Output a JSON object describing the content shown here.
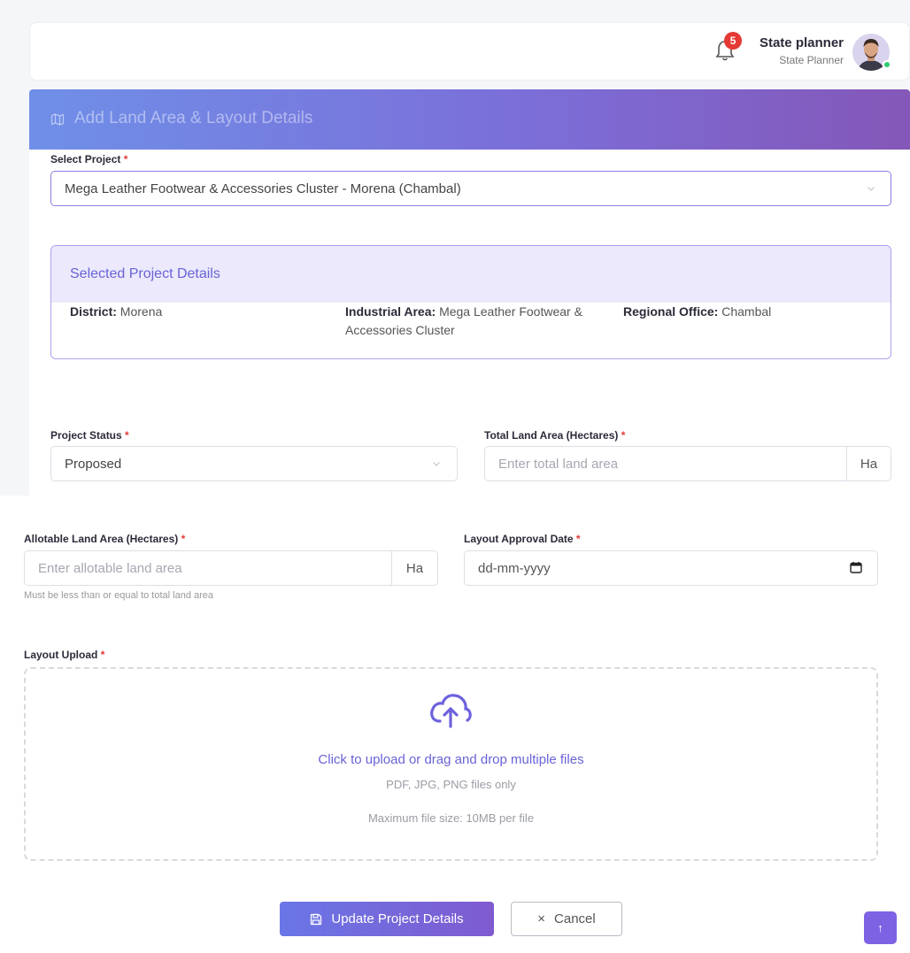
{
  "header": {
    "notification_count": "5",
    "user_name": "State planner",
    "user_role": "State Planner"
  },
  "card": {
    "title": "Add Land Area & Layout Details"
  },
  "form": {
    "select_project": {
      "label": "Select Project",
      "value": "Mega Leather Footwear & Accessories Cluster - Morena (Chambal)"
    },
    "project_details": {
      "heading": "Selected Project Details",
      "district_label": "District:",
      "district_value": "Morena",
      "industrial_area_label": "Industrial Area:",
      "industrial_area_value": "Mega Leather Footwear & Accessories Cluster",
      "regional_office_label": "Regional Office:",
      "regional_office_value": "Chambal"
    },
    "project_status": {
      "label": "Project Status",
      "value": "Proposed"
    },
    "total_land_area": {
      "label": "Total Land Area (Hectares)",
      "placeholder": "Enter total land area",
      "unit": "Ha"
    },
    "allotable_land_area": {
      "label": "Allotable Land Area (Hectares)",
      "placeholder": "Enter allotable land area",
      "unit": "Ha",
      "helper": "Must be less than or equal to total land area"
    },
    "layout_approval_date": {
      "label": "Layout Approval Date",
      "placeholder": "dd-mm-yyyy"
    },
    "layout_upload": {
      "label": "Layout Upload",
      "primary_text": "Click to upload or drag and drop multiple files",
      "types_text": "PDF, JPG, PNG files only",
      "size_text": "Maximum file size: 10MB per file"
    },
    "required_mark": "*"
  },
  "actions": {
    "update_label": "Update Project Details",
    "cancel_label": "Cancel",
    "cancel_glyph": "×",
    "scroll_top_glyph": "↑"
  },
  "colors": {
    "accent": "#7c63e4",
    "header_gradient_start": "#6f8fe8",
    "header_gradient_end": "#8457b8",
    "required": "#e53935",
    "online": "#2ecc71"
  }
}
